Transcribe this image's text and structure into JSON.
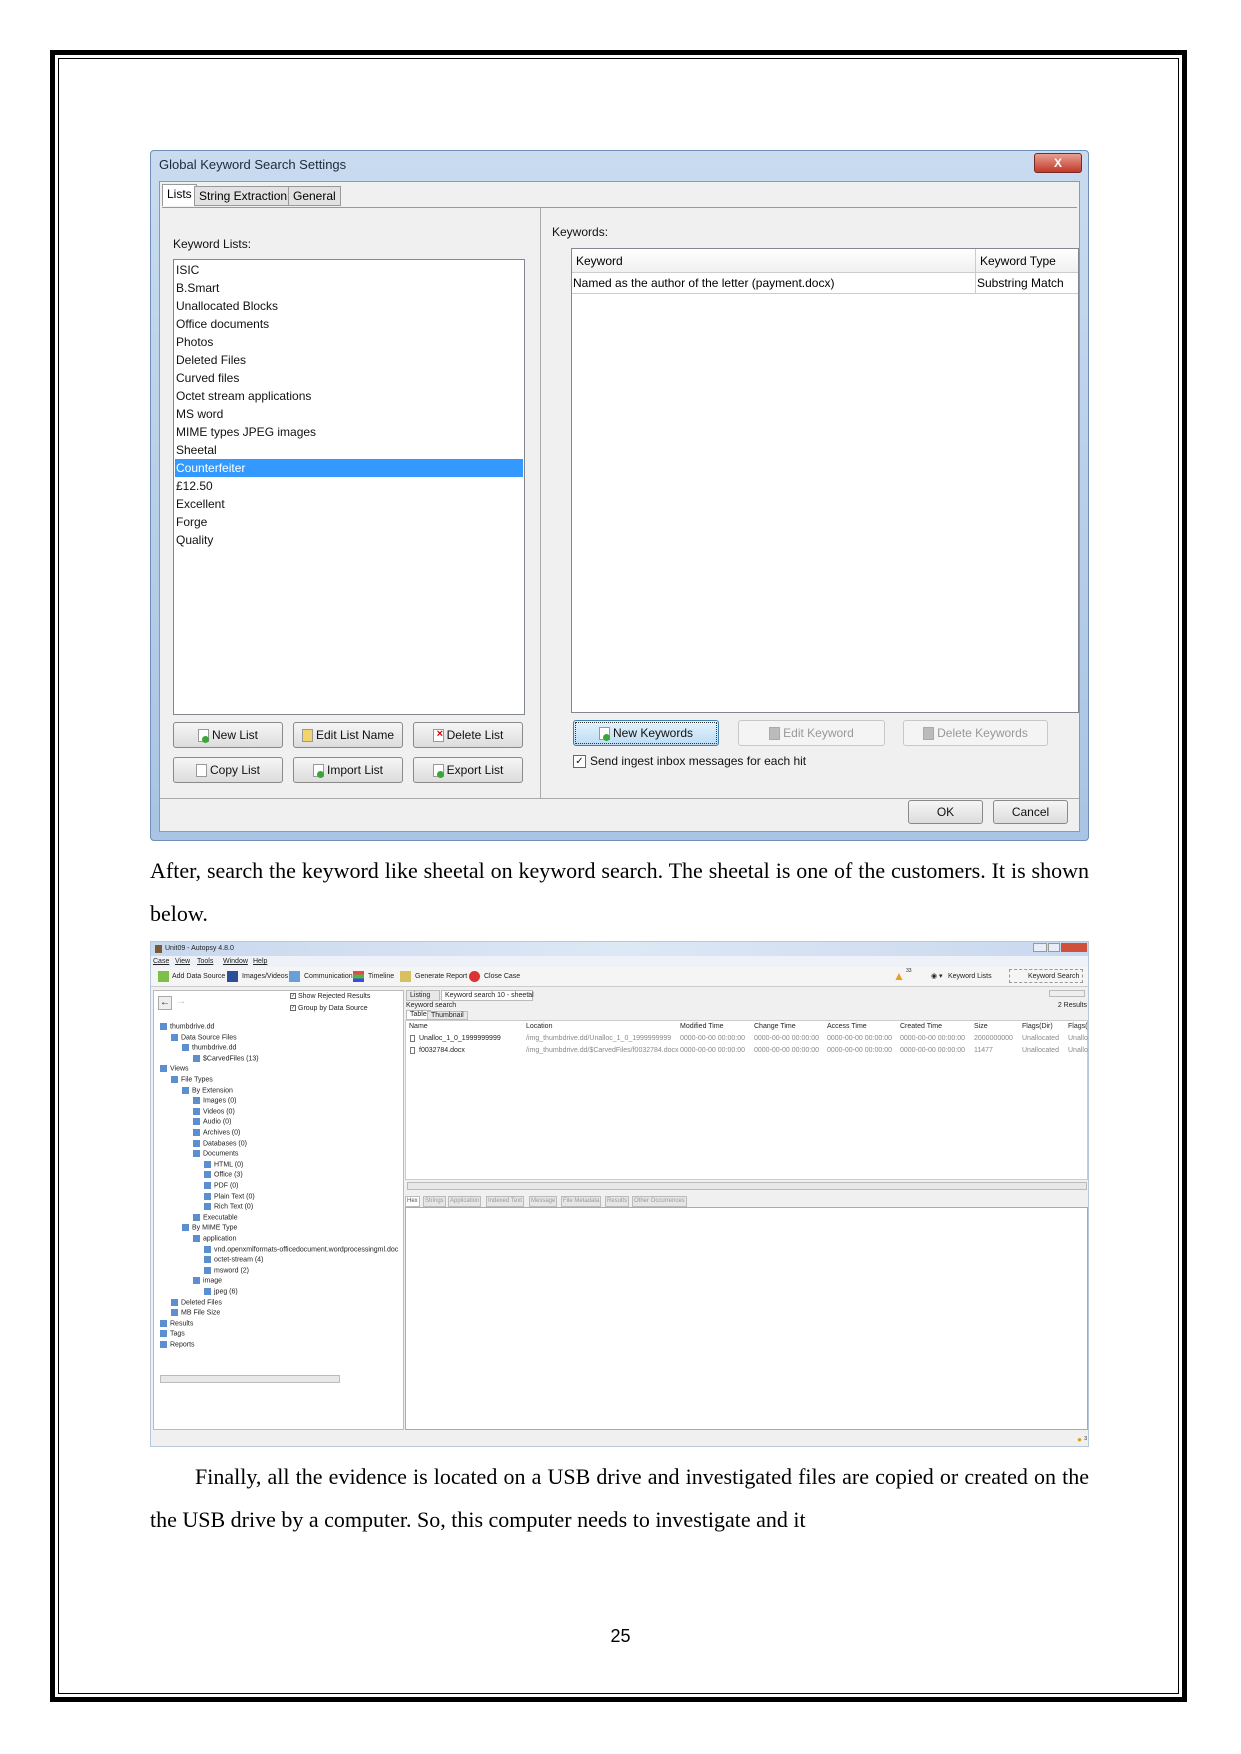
{
  "dialog": {
    "title": "Global Keyword Search Settings",
    "close_label": "X",
    "tabs": [
      "Lists",
      "String Extraction",
      "General"
    ],
    "keyword_lists_label": "Keyword Lists:",
    "keyword_lists": [
      "ISIC",
      "B.Smart",
      "Unallocated Blocks",
      "Office documents",
      "Photos",
      "Deleted Files",
      "Curved files",
      "Octet stream applications",
      "MS word",
      "MIME types JPEG images",
      "Sheetal",
      "Counterfeiter",
      "£12.50",
      "Excellent",
      "Forge",
      "Quality"
    ],
    "selected_list": "Counterfeiter",
    "list_buttons": [
      "New List",
      "Edit List Name",
      "Delete List",
      "Copy List",
      "Import List",
      "Export List"
    ],
    "keywords_label": "Keywords:",
    "keyword_columns": [
      "Keyword",
      "Keyword Type"
    ],
    "keyword_rows": [
      [
        "Named as the author of the letter (payment.docx)",
        "Substring Match"
      ]
    ],
    "keyword_buttons": [
      "New Keywords",
      "Edit Keyword",
      "Delete Keywords"
    ],
    "ingest_checkbox": {
      "label": "Send ingest inbox messages for each hit",
      "checked": true
    },
    "ok": "OK",
    "cancel": "Cancel",
    "selection_color": "#3399ff"
  },
  "text": {
    "para1": "After, search the keyword like sheetal on keyword search. The sheetal is one of the customers. It is shown below.",
    "para2": "Finally, all the evidence is located on a USB drive and investigated files are copied or created on the the USB drive by a computer. So, this computer needs to investigate and it",
    "page_number": "25"
  },
  "autopsy": {
    "title": "Unit09 - Autopsy 4.8.0",
    "menu": [
      "Case",
      "View",
      "Tools",
      "Window",
      "Help"
    ],
    "toolbar": [
      "Add Data Source",
      "Images/Videos",
      "Communications",
      "Timeline",
      "Generate Report",
      "Close Case"
    ],
    "warning_count": "33",
    "keyword_lists": "Keyword Lists",
    "keyword_search": "Keyword Search",
    "show_rejected": "Show Rejected Results",
    "group_by_source": "Group by Data Source",
    "tree": [
      {
        "label": "thumbdrive.dd",
        "level": 0
      },
      {
        "label": "Data Source Files",
        "level": 1
      },
      {
        "label": "thumbdrive.dd",
        "level": 2
      },
      {
        "label": "$CarvedFiles (13)",
        "level": 3
      },
      {
        "label": "Views",
        "level": 0
      },
      {
        "label": "File Types",
        "level": 1
      },
      {
        "label": "By Extension",
        "level": 2
      },
      {
        "label": "Images (0)",
        "level": 3
      },
      {
        "label": "Videos (0)",
        "level": 3
      },
      {
        "label": "Audio (0)",
        "level": 3
      },
      {
        "label": "Archives (0)",
        "level": 3
      },
      {
        "label": "Databases (0)",
        "level": 3
      },
      {
        "label": "Documents",
        "level": 3
      },
      {
        "label": "HTML (0)",
        "level": 4
      },
      {
        "label": "Office (3)",
        "level": 4
      },
      {
        "label": "PDF (0)",
        "level": 4
      },
      {
        "label": "Plain Text (0)",
        "level": 4
      },
      {
        "label": "Rich Text (0)",
        "level": 4
      },
      {
        "label": "Executable",
        "level": 3
      },
      {
        "label": "By MIME Type",
        "level": 2
      },
      {
        "label": "application",
        "level": 3
      },
      {
        "label": "vnd.openxmlformats-officedocument.wordprocessingml.doc",
        "level": 4
      },
      {
        "label": "octet-stream (4)",
        "level": 4
      },
      {
        "label": "msword (2)",
        "level": 4
      },
      {
        "label": "image",
        "level": 3
      },
      {
        "label": "jpeg (6)",
        "level": 4
      },
      {
        "label": "Deleted Files",
        "level": 1
      },
      {
        "label": "MB File Size",
        "level": 1
      },
      {
        "label": "Results",
        "level": 0
      },
      {
        "label": "Tags",
        "level": 0
      },
      {
        "label": "Reports",
        "level": 0
      }
    ],
    "tabs": [
      "Listing",
      "Keyword search 10 - sheetal"
    ],
    "breadcrumb": "Keyword search",
    "results_count": "2 Results",
    "view_tabs": [
      "Table",
      "Thumbnail"
    ],
    "columns": [
      "Name",
      "Location",
      "Modified Time",
      "Change Time",
      "Access Time",
      "Created Time",
      "Size",
      "Flags(Dir)",
      "Flags(Meta)"
    ],
    "rows": [
      [
        "Unalloc_1_0_1999999999",
        "/img_thumbdrive.dd/Unalloc_1_0_1999999999",
        "0000-00-00 00:00:00",
        "0000-00-00 00:00:00",
        "0000-00-00 00:00:00",
        "0000-00-00 00:00:00",
        "2000000000",
        "Unallocated",
        "Unalloc"
      ],
      [
        "f0032784.docx",
        "/img_thumbdrive.dd/$CarvedFiles/f0032784.docx",
        "0000-00-00 00:00:00",
        "0000-00-00 00:00:00",
        "0000-00-00 00:00:00",
        "0000-00-00 00:00:00",
        "11477",
        "Unallocated",
        "Unalloc"
      ]
    ],
    "content_tabs": [
      "Hex",
      "Strings",
      "Application",
      "Indexed Text",
      "Message",
      "File Metadata",
      "Results",
      "Other Occurrences"
    ],
    "status_count": "3"
  }
}
